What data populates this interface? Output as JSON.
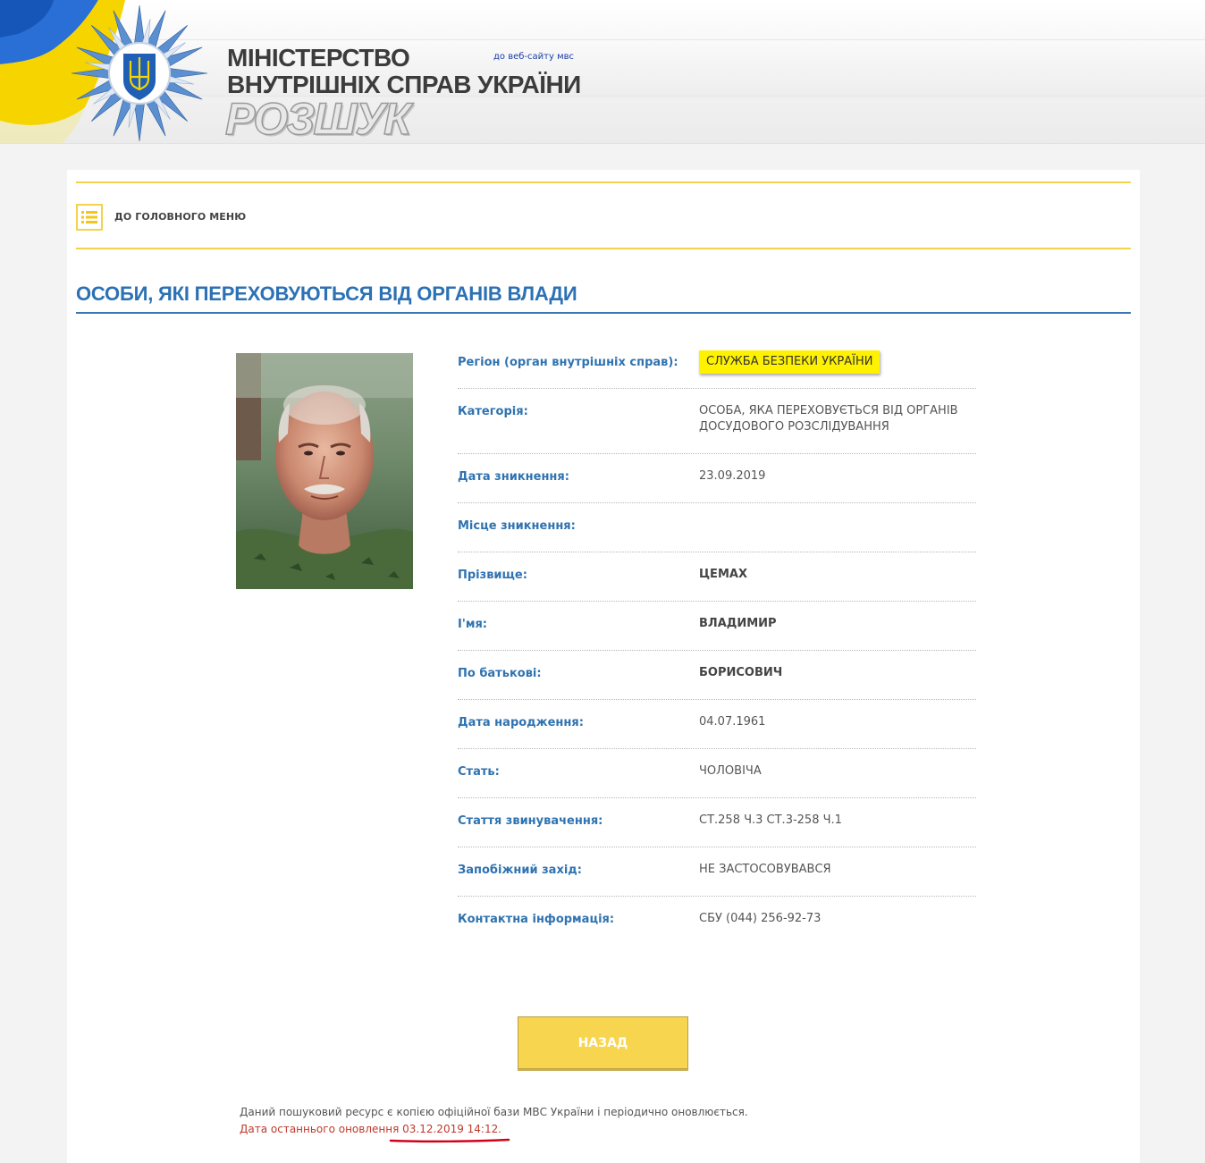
{
  "header": {
    "ministry_line1": "МІНІСТЕРСТВО",
    "ministry_line2": "ВНУТРІШНІХ СПРАВ УКРАЇНИ",
    "site_link": "до веб-сайту мвс",
    "section_title": "РОЗШУК",
    "flag_colors": {
      "blue": "#1a5fb4",
      "yellow": "#f6d400"
    }
  },
  "nav": {
    "menu_icon": "list-icon",
    "main_menu_label": "ДО ГОЛОВНОГО МЕНЮ"
  },
  "page": {
    "title": "ОСОБИ, ЯКІ ПЕРЕХОВУЮТЬСЯ ВІД ОРГАНІВ ВЛАДИ"
  },
  "person": {
    "fields": [
      {
        "label": "Регіон (орган внутрішніх справ):",
        "value": "СЛУЖБА БЕЗПЕКИ УКРАЇНИ"
      },
      {
        "label": "Категорія:",
        "value": "ОСОБА, ЯКА ПЕРЕХОВУЄТЬСЯ ВІД ОРГАНІВ ДОСУДОВОГО РОЗСЛІДУВАННЯ"
      },
      {
        "label": "Дата зникнення:",
        "value": "23.09.2019"
      },
      {
        "label": "Місце зникнення:",
        "value": ""
      },
      {
        "label": "Прізвище:",
        "value": "ЦЕМАХ"
      },
      {
        "label": "І'мя:",
        "value": "ВЛАДИМИР"
      },
      {
        "label": "По батькові:",
        "value": "БОРИСОВИЧ"
      },
      {
        "label": "Дата народження:",
        "value": "04.07.1961"
      },
      {
        "label": "Стать:",
        "value": "ЧОЛОВІЧА"
      },
      {
        "label": "Стаття звинувачення:",
        "value": "СТ.258 Ч.3 СТ.3-258 Ч.1"
      },
      {
        "label": "Запобіжний захід:",
        "value": "НЕ ЗАСТОСОВУВАВСЯ"
      },
      {
        "label": "Контактна інформація:",
        "value": "СБУ (044) 256-92-73"
      }
    ]
  },
  "actions": {
    "back_label": "НАЗАД"
  },
  "footer": {
    "note": "Даний пошуковий ресурс є копією офіційної бази МВС України і періодично оновлюється.",
    "update_prefix": "Дата останнього оновлення",
    "update_date": "03.12.2019 14:12."
  },
  "colors": {
    "accent_blue": "#2c71b4",
    "accent_yellow": "#f5d24a",
    "highlight": "#fff200",
    "annotation_red": "#d0021b"
  }
}
